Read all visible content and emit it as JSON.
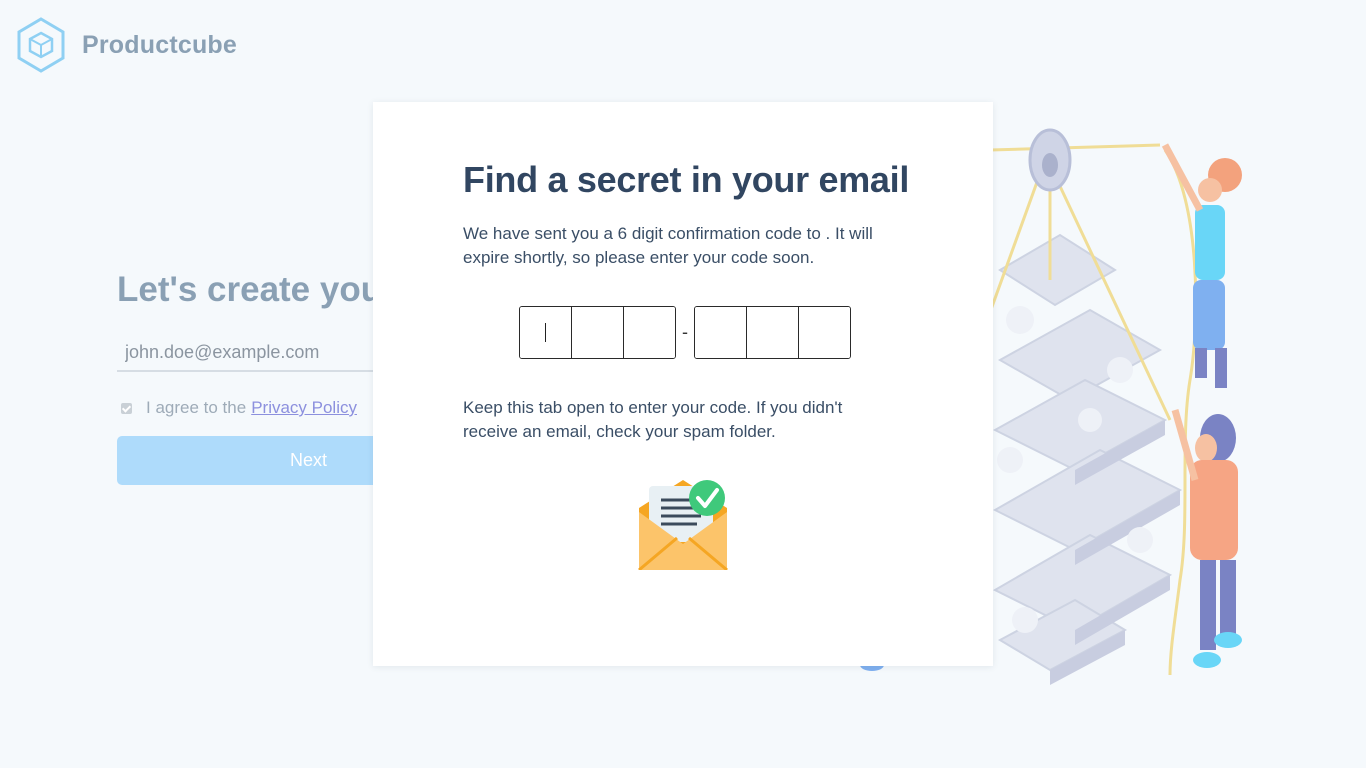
{
  "brand": {
    "name": "Productcube",
    "logo_icon": "hexagon-cube-icon",
    "logo_color": "#8fd0f3"
  },
  "signup": {
    "title": "Let's create your",
    "email_placeholder": "john.doe@example.com",
    "agree_text": "I agree to the",
    "privacy_link": "Privacy Policy",
    "agree_checked": true,
    "next_label": "Next"
  },
  "modal": {
    "title": "Find a secret in your email",
    "description": "We have sent you a 6 digit confirmation code to . It will expire shortly, so please enter your code soon.",
    "code_separator": "-",
    "code_digits": [
      "",
      "",
      "",
      "",
      "",
      ""
    ],
    "active_digit_index": 0,
    "note": "Keep this tab open to enter your code. If you didn't receive an email, check your spam folder.",
    "envelope_icon": "open-envelope-check-icon"
  },
  "colors": {
    "title": "#314661",
    "primary_button": "#aedbfb",
    "link": "#8c90de",
    "background": "#f5f9fc"
  }
}
